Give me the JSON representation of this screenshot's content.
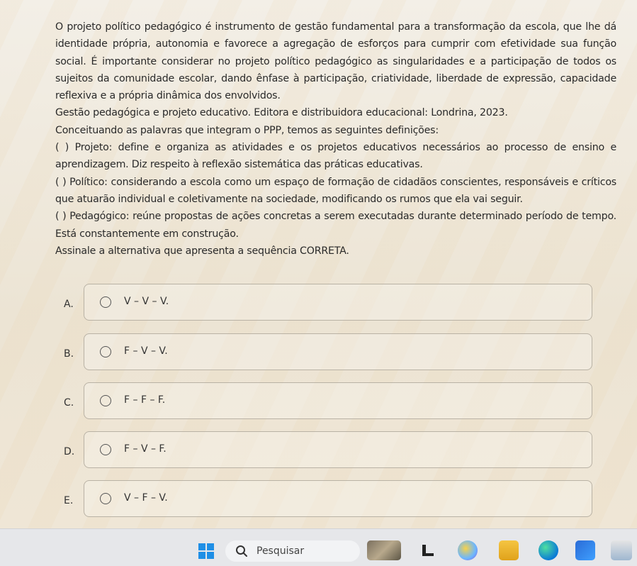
{
  "question": {
    "paragraph1": "O projeto político pedagógico é instrumento de gestão fundamental para a transformação da escola, que lhe dá identidade própria, autonomia e favorece a agregação de esforços para cumprir com efetividade sua função social. É importante considerar no projeto político pedagógico as singularidades e a participação de todos os sujeitos da comunidade escolar, dando ênfase à participação, criatividade, liberdade de expressão, capacidade reflexiva e a própria dinâmica dos envolvidos.",
    "source": "Gestão pedagógica e projeto educativo. Editora e distribuidora educacional: Londrina, 2023.",
    "intro": "Conceituando as palavras que integram o PPP, temos as seguintes definições:",
    "item1": "( ) Projeto: define e organiza as atividades e os projetos educativos necessários ao processo de ensino e aprendizagem. Diz respeito à reflexão sistemática das práticas educativas.",
    "item2": "( ) Político: considerando a escola como um espaço de formação de cidadãos conscientes, responsáveis e críticos que atuarão individual e coletivamente na sociedade, modificando os rumos que ela vai seguir.",
    "item3": "( ) Pedagógico: reúne propostas de ações concretas a serem executadas durante determinado período de tempo. Está constantemente em construção.",
    "instruction": "Assinale a alternativa que apresenta a sequência CORRETA."
  },
  "options": [
    {
      "letter": "A.",
      "text": "V – V – V."
    },
    {
      "letter": "B.",
      "text": "F – V – V."
    },
    {
      "letter": "C.",
      "text": "F – F – F."
    },
    {
      "letter": "D.",
      "text": "F – V – F."
    },
    {
      "letter": "E.",
      "text": "V – F – V."
    }
  ],
  "taskbar": {
    "search_label": "Pesquisar",
    "icons": [
      "windows-start-icon",
      "search-icon",
      "photo-thumbnail-icon",
      "media-icon",
      "app-icon",
      "file-explorer-icon",
      "edge-browser-icon",
      "store-icon",
      "weather-icon"
    ],
    "accent": "#1f8fe6"
  }
}
